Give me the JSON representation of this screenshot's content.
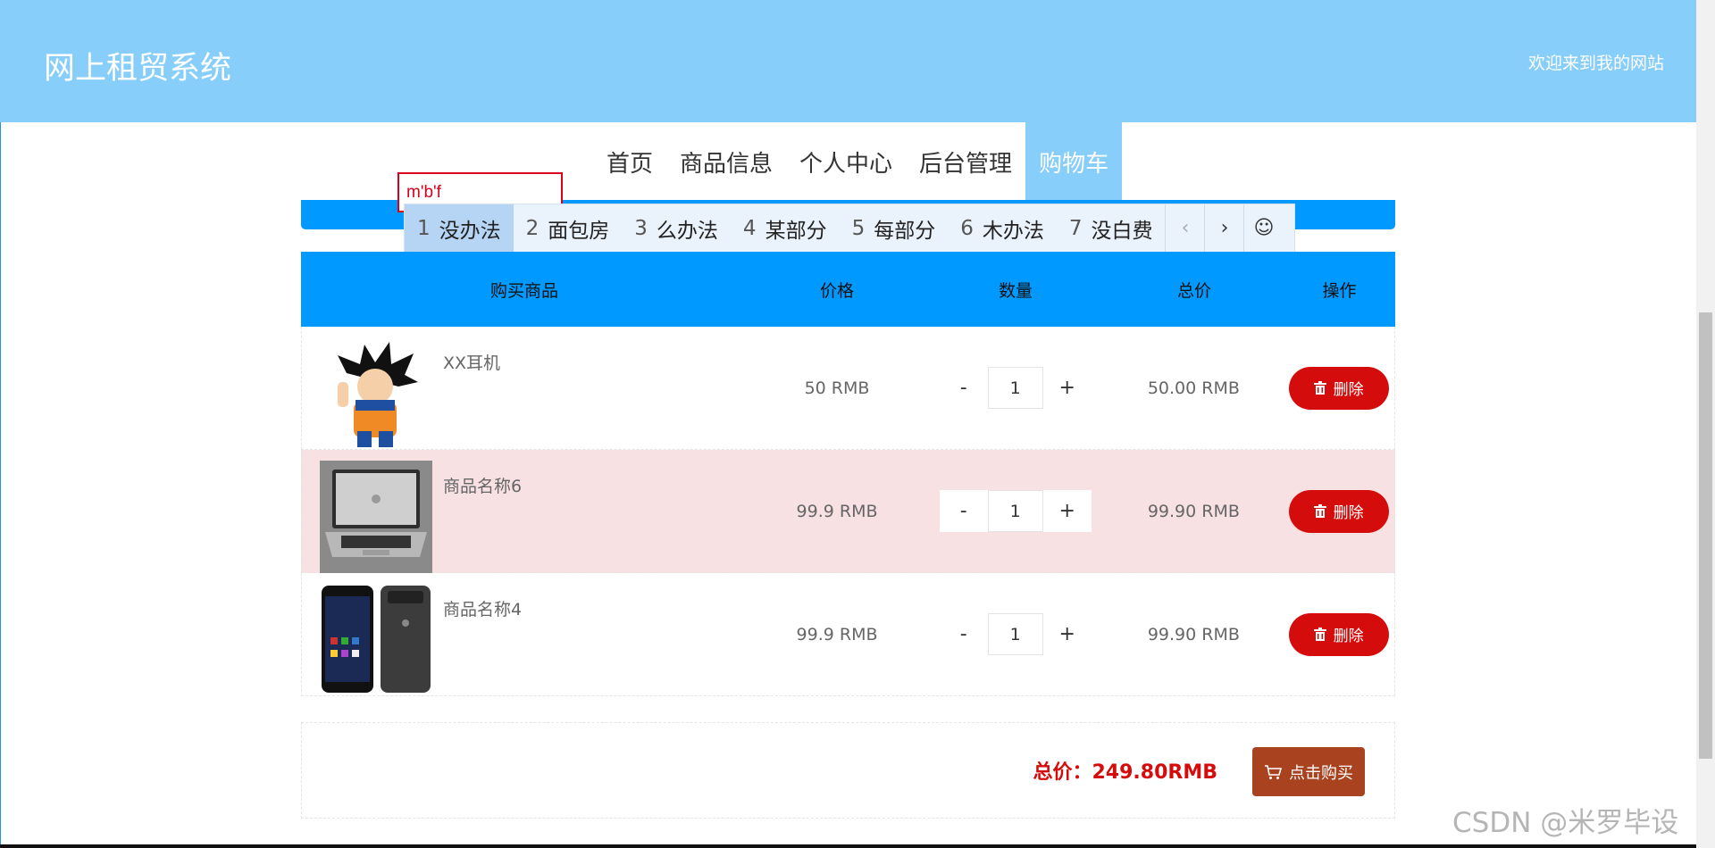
{
  "header": {
    "title": "网上租贸系统",
    "welcome": "欢迎来到我的网站"
  },
  "nav": {
    "items": [
      {
        "label": "首页",
        "active": false
      },
      {
        "label": "商品信息",
        "active": false
      },
      {
        "label": "个人中心",
        "active": false
      },
      {
        "label": "后台管理",
        "active": false
      },
      {
        "label": "购物车",
        "active": true
      }
    ]
  },
  "ime": {
    "input_text": "m'b'f",
    "candidates": [
      {
        "num": "1",
        "text": "没办法"
      },
      {
        "num": "2",
        "text": "面包房"
      },
      {
        "num": "3",
        "text": "么办法"
      },
      {
        "num": "4",
        "text": "某部分"
      },
      {
        "num": "5",
        "text": "每部分"
      },
      {
        "num": "6",
        "text": "木办法"
      },
      {
        "num": "7",
        "text": "没白费"
      }
    ],
    "prev_glyph": "‹",
    "next_glyph": "›",
    "emoji_glyph": "☺"
  },
  "cart": {
    "headers": {
      "product": "购买商品",
      "price": "价格",
      "quantity": "数量",
      "total": "总价",
      "action": "操作"
    },
    "rows": [
      {
        "name": "XX耳机",
        "price": "50 RMB",
        "quantity": "1",
        "total": "50.00 RMB",
        "image": "anime-figure"
      },
      {
        "name": "商品名称6",
        "price": "99.9 RMB",
        "quantity": "1",
        "total": "99.90 RMB",
        "image": "laptop"
      },
      {
        "name": "商品名称4",
        "price": "99.9 RMB",
        "quantity": "1",
        "total": "99.90 RMB",
        "image": "smartphones"
      }
    ],
    "minus": "-",
    "plus": "+",
    "delete_label": "删除"
  },
  "summary": {
    "total_text": "总价：249.80RMB",
    "buy_label": "点击购买"
  },
  "watermark": "CSDN @米罗毕设",
  "colors": {
    "header": "#87cefa",
    "table_header": "#0099ff",
    "delete": "#d50c0c",
    "buy": "#a9431f",
    "highlight_row": "#f7e1e3"
  }
}
